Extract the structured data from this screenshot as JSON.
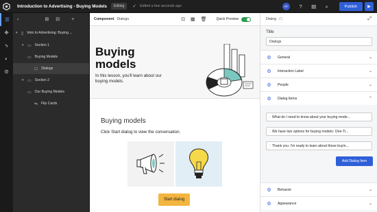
{
  "topbar": {
    "title": "Introduction to Advertising - Buying Models",
    "mode_badge": "Editing",
    "save_status": "Edited a few seconds ago",
    "avatar_initials": "AT",
    "publish_label": "Publish"
  },
  "outline": {
    "items": [
      {
        "label": "Intro to Advertising: Buying ...",
        "type": "course"
      },
      {
        "label": "Section 1",
        "type": "section"
      },
      {
        "label": "Buying Models",
        "type": "page"
      },
      {
        "label": "Dialogs",
        "type": "component"
      },
      {
        "label": "Section 2",
        "type": "section"
      },
      {
        "label": "Our Buying Models",
        "type": "page"
      },
      {
        "label": "Flip Cards",
        "type": "component"
      }
    ]
  },
  "canvas": {
    "component_label": "Component",
    "component_value": "Dialogs",
    "quick_preview_label": "Quick Preview",
    "hero_title": "Buying models",
    "hero_subtitle": "In this lesson, you'll learn about our buying models.",
    "content_title": "Buying models",
    "content_instruction": "Click Start dialog to view the conversation.",
    "start_button": "Start dialog"
  },
  "props": {
    "header": "Dialog",
    "title_label": "Title",
    "title_value": "Dialogs",
    "sections": {
      "general": "General",
      "interaction_label": "Interaction Label",
      "people": "People",
      "dialog_items": "Dialog Items",
      "behavior": "Behavior",
      "appearance": "Appearance"
    },
    "dialog_items": [
      "What do I need to know about your buying mode...",
      "We have two options for buying models: One-Ti...",
      "Thank you. I'm ready to learn about these buyin..."
    ],
    "add_button": "Add Dialog Item"
  },
  "colors": {
    "accent_blue": "#2f5fd8",
    "start_button": "#f3b53f",
    "toggle_on": "#2e9b4f"
  }
}
